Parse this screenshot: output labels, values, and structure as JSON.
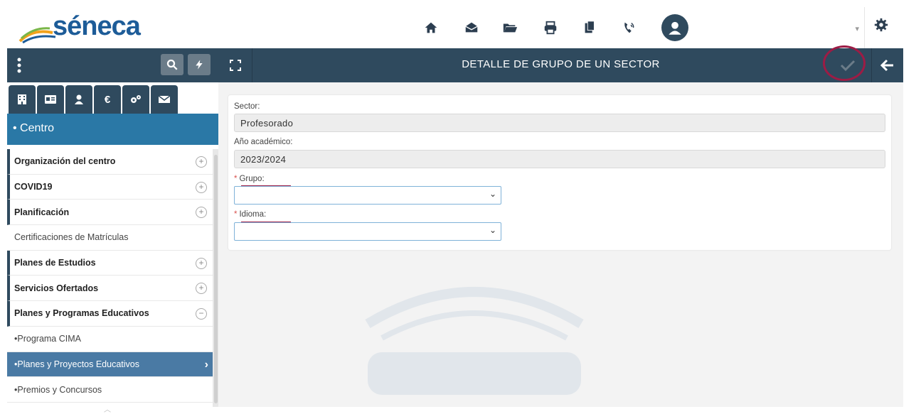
{
  "header": {
    "logo": "séneca",
    "icons": [
      "home-icon",
      "mail-icon",
      "folder-icon",
      "print-icon",
      "documents-icon",
      "phone-icon"
    ],
    "user_avatar": "user-icon",
    "settings_icon": "gear-icon"
  },
  "sidebar": {
    "tabs": [
      "building-icon",
      "id-card-icon",
      "user-icon",
      "euro-icon",
      "cogs-icon",
      "mail-icon"
    ],
    "section_title": "• Centro",
    "items": [
      {
        "label": "Organización del centro",
        "expandable": true
      },
      {
        "label": "COVID19",
        "expandable": true
      },
      {
        "label": "Planificación",
        "expandable": true
      },
      {
        "label": "Certificaciones de Matrículas",
        "expandable": false
      },
      {
        "label": "Planes de Estudios",
        "expandable": true
      },
      {
        "label": "Servicios Ofertados",
        "expandable": true
      },
      {
        "label": "Planes y Programas Educativos",
        "expandable": true
      },
      {
        "label": "•Programa CIMA",
        "expandable": false
      },
      {
        "label": "•Planes y Proyectos Educativos",
        "active": true
      },
      {
        "label": "•Premios y Concursos",
        "expandable": false
      }
    ]
  },
  "main": {
    "title": "DETALLE DE GRUPO DE UN SECTOR",
    "form": {
      "sector_label": "Sector:",
      "sector_value": "Profesorado",
      "year_label": "Año académico:",
      "year_value": "2023/2024",
      "group_label": "Grupo:",
      "group_value": "",
      "language_label": "Idioma:",
      "language_value": ""
    }
  },
  "colors": {
    "header_bar": "#2f4a5e",
    "section_blue": "#2a78a6",
    "active_item": "#4a7aa4",
    "highlight": "#9c1c45"
  }
}
